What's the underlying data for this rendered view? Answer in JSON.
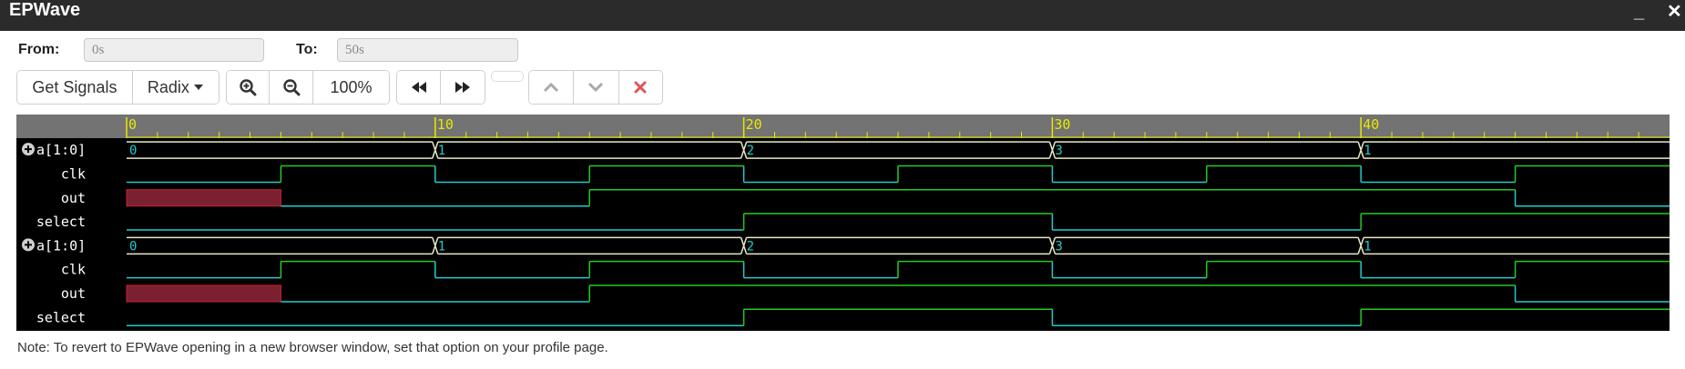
{
  "window": {
    "title": "EPWave",
    "minimize_glyph": "_",
    "close_glyph": "✕"
  },
  "range": {
    "from_label": "From:",
    "from_value": "0s",
    "to_label": "To:",
    "to_value": "50s"
  },
  "toolbar": {
    "get_signals": "Get Signals",
    "radix": "Radix",
    "zoom_level": "100%"
  },
  "icons": {
    "zoom_in": "zoom-in-icon",
    "zoom_out": "zoom-out-icon",
    "prev": "rewind-icon",
    "next": "fast-forward-icon",
    "up": "chevron-up-icon",
    "down": "chevron-down-icon",
    "remove": "close-icon"
  },
  "timeline": {
    "start": 0,
    "end": 50,
    "major_ticks": [
      0,
      10,
      20,
      30,
      40
    ],
    "major_labels": [
      "0",
      "10",
      "20",
      "30",
      "40"
    ]
  },
  "signals": [
    {
      "name": "a[1:0]",
      "type": "bus",
      "expandable": true,
      "segments": [
        {
          "start": 0,
          "end": 10,
          "value": "0"
        },
        {
          "start": 10,
          "end": 20,
          "value": "1"
        },
        {
          "start": 20,
          "end": 30,
          "value": "2"
        },
        {
          "start": 30,
          "end": 40,
          "value": "3"
        },
        {
          "start": 40,
          "end": 50,
          "value": "1"
        }
      ]
    },
    {
      "name": "clk",
      "type": "bit",
      "segments": [
        {
          "start": 0,
          "end": 5,
          "value": 0
        },
        {
          "start": 5,
          "end": 10,
          "value": 1
        },
        {
          "start": 10,
          "end": 15,
          "value": 0
        },
        {
          "start": 15,
          "end": 20,
          "value": 1
        },
        {
          "start": 20,
          "end": 25,
          "value": 0
        },
        {
          "start": 25,
          "end": 30,
          "value": 1
        },
        {
          "start": 30,
          "end": 35,
          "value": 0
        },
        {
          "start": 35,
          "end": 40,
          "value": 1
        },
        {
          "start": 40,
          "end": 45,
          "value": 0
        },
        {
          "start": 45,
          "end": 50,
          "value": 1
        }
      ]
    },
    {
      "name": "out",
      "type": "bit",
      "segments": [
        {
          "start": 0,
          "end": 5,
          "value": "x"
        },
        {
          "start": 5,
          "end": 15,
          "value": 0
        },
        {
          "start": 15,
          "end": 45,
          "value": 1
        },
        {
          "start": 45,
          "end": 50,
          "value": 0
        }
      ]
    },
    {
      "name": "select",
      "type": "bit",
      "segments": [
        {
          "start": 0,
          "end": 20,
          "value": 0
        },
        {
          "start": 20,
          "end": 30,
          "value": 1
        },
        {
          "start": 30,
          "end": 40,
          "value": 0
        },
        {
          "start": 40,
          "end": 50,
          "value": 1
        }
      ]
    },
    {
      "name": "a[1:0]",
      "type": "bus",
      "expandable": true,
      "segments": [
        {
          "start": 0,
          "end": 10,
          "value": "0"
        },
        {
          "start": 10,
          "end": 20,
          "value": "1"
        },
        {
          "start": 20,
          "end": 30,
          "value": "2"
        },
        {
          "start": 30,
          "end": 40,
          "value": "3"
        },
        {
          "start": 40,
          "end": 50,
          "value": "1"
        }
      ]
    },
    {
      "name": "clk",
      "type": "bit",
      "segments": [
        {
          "start": 0,
          "end": 5,
          "value": 0
        },
        {
          "start": 5,
          "end": 10,
          "value": 1
        },
        {
          "start": 10,
          "end": 15,
          "value": 0
        },
        {
          "start": 15,
          "end": 20,
          "value": 1
        },
        {
          "start": 20,
          "end": 25,
          "value": 0
        },
        {
          "start": 25,
          "end": 30,
          "value": 1
        },
        {
          "start": 30,
          "end": 35,
          "value": 0
        },
        {
          "start": 35,
          "end": 40,
          "value": 1
        },
        {
          "start": 40,
          "end": 45,
          "value": 0
        },
        {
          "start": 45,
          "end": 50,
          "value": 1
        }
      ]
    },
    {
      "name": "out",
      "type": "bit",
      "segments": [
        {
          "start": 0,
          "end": 5,
          "value": "x"
        },
        {
          "start": 5,
          "end": 15,
          "value": 0
        },
        {
          "start": 15,
          "end": 45,
          "value": 1
        },
        {
          "start": 45,
          "end": 50,
          "value": 0
        }
      ]
    },
    {
      "name": "select",
      "type": "bit",
      "segments": [
        {
          "start": 0,
          "end": 20,
          "value": 0
        },
        {
          "start": 20,
          "end": 30,
          "value": 1
        },
        {
          "start": 30,
          "end": 40,
          "value": 0
        },
        {
          "start": 40,
          "end": 50,
          "value": 1
        }
      ]
    }
  ],
  "colors": {
    "titlebar": "#2b2b2b",
    "ruler_bg": "#737373",
    "ruler_ticks": "#e8e800",
    "wave_bg": "#000000",
    "high": "#22cc22",
    "low": "#22cccc",
    "bus": "#e8e8c8",
    "bus_text": "#22cccc",
    "unknown_fill": "#7a2030",
    "unknown_stroke": "#cc2233",
    "remove": "#e05555"
  },
  "note": "Note: To revert to EPWave opening in a new browser window, set that option on your profile page."
}
